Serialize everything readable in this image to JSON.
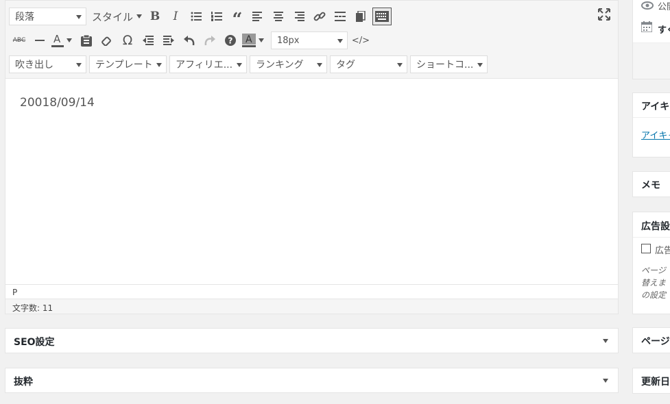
{
  "toolbar": {
    "format_select": "段落",
    "style_menu": "スタイル",
    "font_size_select": "18px",
    "balloon_select": "吹き出し",
    "template_select": "テンプレート",
    "affiliate_select": "アフィリエ...",
    "ranking_select": "ランキング",
    "tag_select": "タグ",
    "shortcode_select": "ショートコ...",
    "icons": [
      "bold-icon",
      "italic-icon",
      "bullet-list-icon",
      "numbered-list-icon",
      "blockquote-icon",
      "align-left-icon",
      "align-center-icon",
      "align-right-icon",
      "link-icon",
      "read-more-icon",
      "paste-icon",
      "toolbar-toggle-icon",
      "fullscreen-icon",
      "strikethrough-icon",
      "horizontal-line-icon",
      "text-color-icon",
      "paste-text-icon",
      "clear-formatting-icon",
      "special-character-icon",
      "outdent-icon",
      "indent-icon",
      "undo-icon",
      "redo-icon",
      "help-icon",
      "background-color-icon",
      "html-tag-icon"
    ]
  },
  "editor": {
    "content": "20018/09/14",
    "path": "P",
    "word_count": "文字数: 11"
  },
  "postboxes": {
    "seo": "SEO設定",
    "excerpt": "抜粋"
  },
  "sidebar": {
    "visibility": "公開",
    "schedule": "すぐ",
    "eyecatch_title": "アイキ",
    "eyecatch_link": "アイキャ",
    "memo_title": "メモ",
    "ad_title": "広告設",
    "ad_checkbox_label": "広告",
    "ad_note": [
      "ページ",
      "替えま",
      "の設定"
    ],
    "page_title": "ページ",
    "update_title": "更新日"
  }
}
